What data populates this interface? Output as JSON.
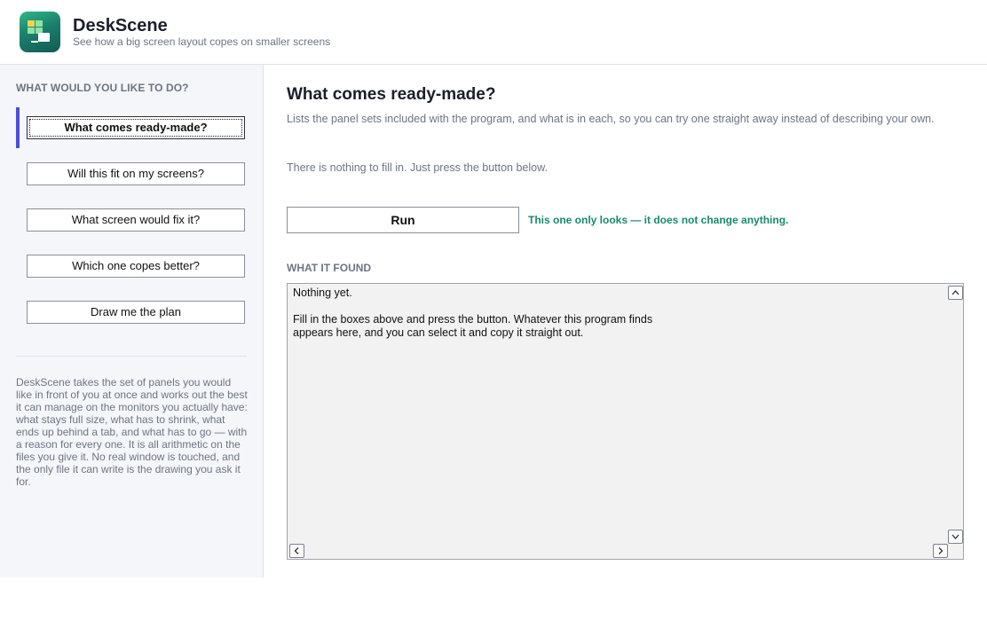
{
  "app": {
    "title": "DeskScene",
    "subtitle": "See how a big screen layout copes on smaller screens",
    "logo_icon": "desk-monitor-icon"
  },
  "sidebar": {
    "heading": "WHAT WOULD YOU LIKE TO DO?",
    "items": [
      {
        "label": "What comes ready-made?",
        "active": true
      },
      {
        "label": "Will this fit on my screens?",
        "active": false
      },
      {
        "label": "What screen would fix it?",
        "active": false
      },
      {
        "label": "Which one copes better?",
        "active": false
      },
      {
        "label": "Draw me the plan",
        "active": false
      }
    ],
    "description": "DeskScene takes the set of panels you would like in front of you at once and works out the best it can manage on the monitors you actually have: what stays full size, what has to shrink, what ends up behind a tab, and what has to go — with a reason for every one. It is all arithmetic on the files you give it. No real window is touched, and the only file it can write is the drawing you ask it for."
  },
  "main": {
    "title": "What comes ready-made?",
    "description": "Lists the panel sets included with the program, and what is in each, so you can try one straight away instead of describing your own.",
    "note": "There is nothing to fill in. Just press the button below.",
    "run_label": "Run",
    "run_note": "This one only looks — it does not change anything.",
    "found_label": "WHAT IT FOUND",
    "output": "Nothing yet.\n\nFill in the boxes above and press the button. Whatever this program finds\nappears here, and you can select it and copy it straight out."
  },
  "colors": {
    "accent": "#4b4fd8",
    "success_text": "#178a6d",
    "logo_green": "#1b7f6c",
    "muted_text": "#6b7585"
  }
}
